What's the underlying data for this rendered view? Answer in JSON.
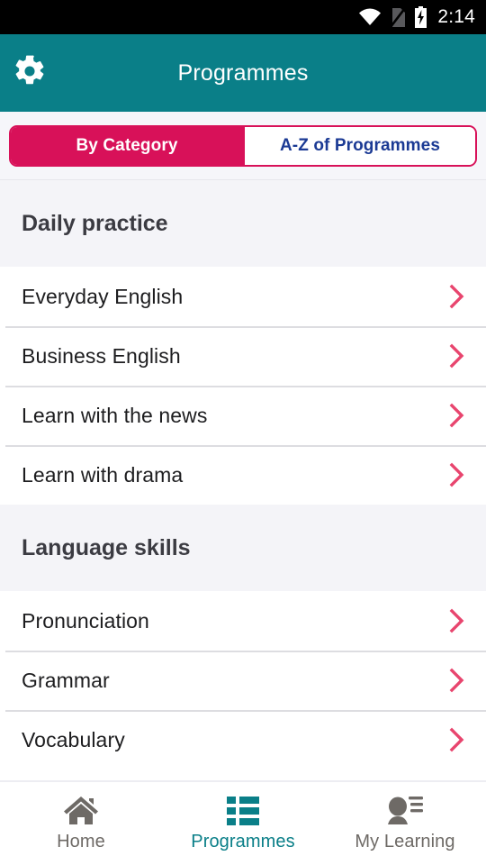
{
  "statusbar": {
    "time": "2:14",
    "icons": [
      "wifi-icon",
      "no-sim-icon",
      "battery-charging-icon"
    ]
  },
  "header": {
    "title": "Programmes",
    "settings_icon": "gear-icon",
    "background_color": "#0a7f88"
  },
  "tabs": {
    "accent_color": "#d81159",
    "inactive_text_color": "#1b3a94",
    "items": [
      {
        "label": "By Category",
        "active": true
      },
      {
        "label": "A-Z of Programmes",
        "active": false
      }
    ]
  },
  "list": {
    "chevron_icon": "chevron-right-icon",
    "chevron_color": "#e8456e",
    "sections": [
      {
        "title": "Daily practice",
        "items": [
          {
            "label": "Everyday English"
          },
          {
            "label": "Business English"
          },
          {
            "label": "Learn with the news"
          },
          {
            "label": "Learn with drama"
          }
        ]
      },
      {
        "title": "Language skills",
        "items": [
          {
            "label": "Pronunciation"
          },
          {
            "label": "Grammar"
          },
          {
            "label": "Vocabulary"
          }
        ]
      }
    ]
  },
  "bottomnav": {
    "active_color": "#0a7f88",
    "inactive_color": "#6e6a66",
    "items": [
      {
        "label": "Home",
        "icon": "home-icon",
        "active": false
      },
      {
        "label": "Programmes",
        "icon": "grid-list-icon",
        "active": true
      },
      {
        "label": "My Learning",
        "icon": "person-lines-icon",
        "active": false
      }
    ]
  }
}
